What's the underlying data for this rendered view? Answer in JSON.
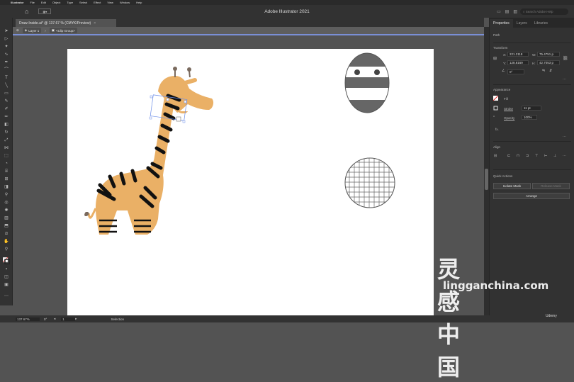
{
  "mac_menu": {
    "app_name": "Illustrator",
    "items": [
      "File",
      "Edit",
      "Object",
      "Type",
      "Select",
      "Effect",
      "View",
      "Window",
      "Help"
    ]
  },
  "app_bar": {
    "title": "Adobe Illustrator 2021",
    "search_placeholder": "Search Adobe Help"
  },
  "document": {
    "tab_title": "Draw-Inside.ai* @ 137.67 % (CMYK/Preview)"
  },
  "isolation": {
    "layer_label": "Layer 1",
    "group_label": "<Clip Group>"
  },
  "panel": {
    "tabs": [
      "Properties",
      "Layers",
      "Libraries"
    ],
    "object_type": "Path",
    "transform": {
      "title": "Transform",
      "x_label": "X:",
      "x_value": "221.2118",
      "y_label": "Y:",
      "y_value": "128.8169",
      "w_label": "W:",
      "w_value": "75.4751 p",
      "h_label": "H:",
      "h_value": "42.7053 p",
      "angle_value": "0°"
    },
    "appearance": {
      "title": "Appearance",
      "fill_label": "Fill",
      "stroke_label": "Stroke",
      "stroke_value": "11 pt",
      "opacity_label": "Opacity",
      "opacity_value": "100%",
      "fx_label": "fx."
    },
    "align": {
      "title": "Align"
    },
    "quick_actions": {
      "title": "Quick Actions",
      "isolate_mask": "Isolate Mask",
      "release_mask": "Release Mask",
      "arrange": "Arrange"
    }
  },
  "status": {
    "zoom": "137.67%",
    "rotation": "0°",
    "page": "1",
    "mode": "Selection"
  },
  "watermark": {
    "cn": "灵感中国",
    "en": "lingganchina.com"
  },
  "udemy_label": "Udemy",
  "colors": {
    "giraffe": "#eab066",
    "stripe": "#111111",
    "ui_dark": "#323232",
    "canvas": "#535353",
    "selection_blue": "#6d8ee8"
  }
}
